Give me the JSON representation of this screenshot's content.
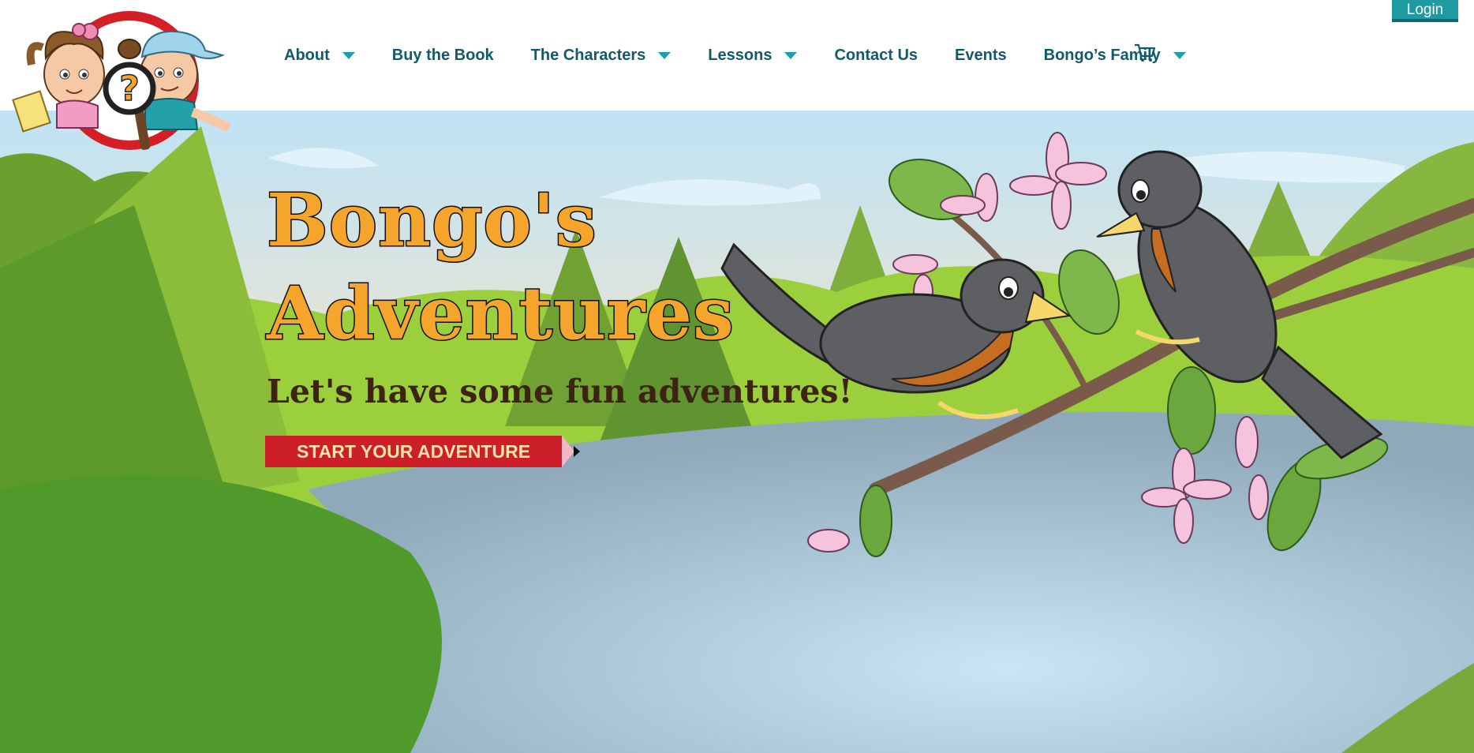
{
  "header": {
    "logo_name": "bongo-logo",
    "login_label": "Login",
    "cart_icon": "shopping-cart-icon"
  },
  "nav": {
    "items": [
      {
        "label": "About",
        "dropdown": true
      },
      {
        "label": "Buy the Book",
        "dropdown": false
      },
      {
        "label": "The Characters",
        "dropdown": true
      },
      {
        "label": "Lessons",
        "dropdown": true
      },
      {
        "label": "Contact Us",
        "dropdown": false
      },
      {
        "label": "Events",
        "dropdown": false
      },
      {
        "label": "Bongo’s Family",
        "dropdown": true
      }
    ]
  },
  "hero": {
    "title_line1": "Bongo's",
    "title_line2": "Adventures",
    "tagline": "Let's have some fun adventures!",
    "cta_label": "START YOUR ADVENTURE"
  },
  "colors": {
    "nav_text": "#115a6b",
    "accent_teal": "#1e9aa3",
    "title_orange": "#f5a52c",
    "cta_red": "#cc1f2a"
  }
}
